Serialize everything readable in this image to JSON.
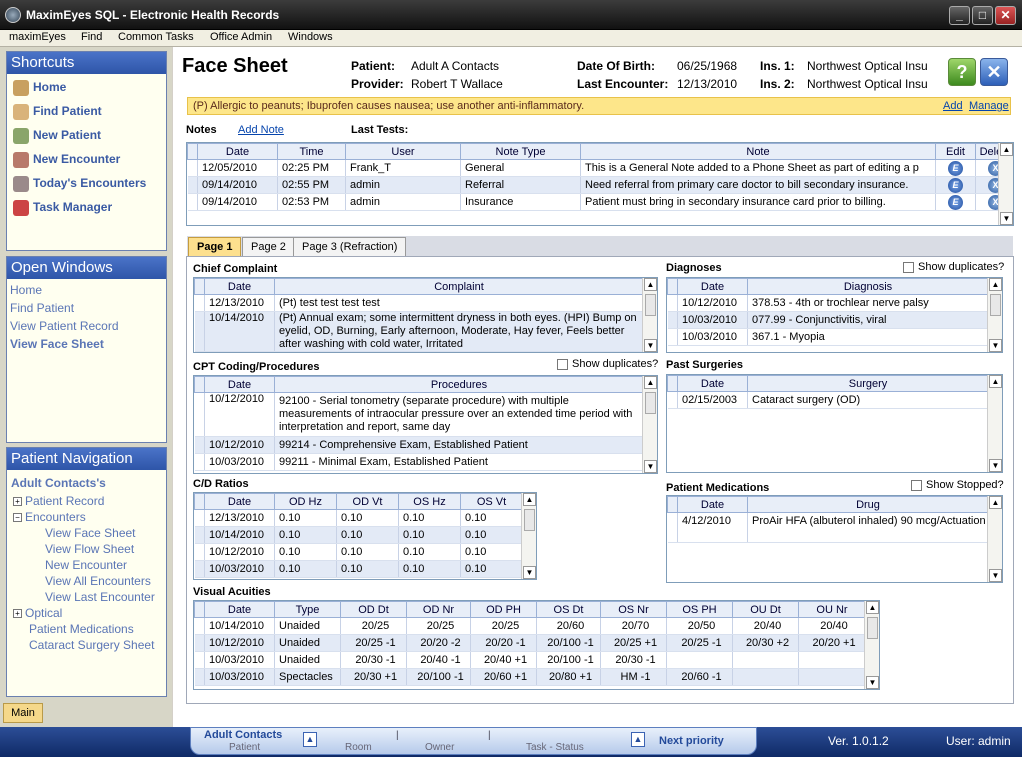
{
  "window": {
    "title": "MaximEyes SQL - Electronic Health Records"
  },
  "menu": [
    "maximEyes",
    "Find",
    "Common Tasks",
    "Office Admin",
    "Windows"
  ],
  "shortcuts": {
    "title": "Shortcuts",
    "items": [
      "Home",
      "Find Patient",
      "New Patient",
      "New Encounter",
      "Today's Encounters",
      "Task Manager"
    ]
  },
  "open_windows": {
    "title": "Open Windows",
    "items": [
      "Home",
      "Find Patient",
      "View Patient Record",
      "View Face Sheet"
    ]
  },
  "patient_nav": {
    "title": "Patient Navigation",
    "patient": "Adult Contacts's",
    "patient_record": "Patient Record",
    "encounters": "Encounters",
    "enc_items": [
      "View Face Sheet",
      "View Flow Sheet",
      "New Encounter",
      "View All Encounters",
      "View Last Encounter"
    ],
    "optical": "Optical",
    "medications": "Patient Medications",
    "cataract": "Cataract Surgery Sheet"
  },
  "main_tab": "Main",
  "header": {
    "title": "Face Sheet",
    "patient_label": "Patient:",
    "patient": "Adult A Contacts",
    "provider_label": "Provider:",
    "provider": "Robert T Wallace",
    "dob_label": "Date Of Birth:",
    "dob": "06/25/1968",
    "last_enc_label": "Last Encounter:",
    "last_enc": "12/13/2010",
    "ins1_label": "Ins. 1:",
    "ins1": "Northwest  Optical Insu",
    "ins2_label": "Ins. 2:",
    "ins2": "Northwest  Optical Insu"
  },
  "alert": {
    "text": "(P) Allergic to peanuts; Ibuprofen causes nausea; use another anti-inflammatory.",
    "add": "Add",
    "manage": "Manage"
  },
  "notes": {
    "label": "Notes",
    "add_note": "Add Note",
    "last_tests": "Last Tests:",
    "columns": [
      "Date",
      "Time",
      "User",
      "Note Type",
      "Note",
      "Edit",
      "Delete"
    ],
    "rows": [
      [
        "12/05/2010",
        "02:25 PM",
        "Frank_T",
        "General",
        "This is a General Note added to a Phone Sheet as part of editing a p"
      ],
      [
        "09/14/2010",
        "02:55 PM",
        "admin",
        "Referral",
        "Need referral from primary care doctor to bill secondary insurance."
      ],
      [
        "09/14/2010",
        "02:53 PM",
        "admin",
        "Insurance",
        "Patient must bring in secondary insurance card prior to billing."
      ]
    ]
  },
  "tabs": [
    "Page 1",
    "Page 2",
    "Page 3 (Refraction)"
  ],
  "chief": {
    "title": "Chief Complaint",
    "columns": [
      "Date",
      "Complaint"
    ],
    "rows": [
      [
        "12/13/2010",
        "(Pt) test test test test"
      ],
      [
        "10/14/2010",
        "(Pt) Annual exam; some intermittent dryness in both eyes. (HPI) Bump on eyelid, OD, Burning, Early afternoon, Moderate, Hay fever, Feels better after washing with cold water, Irritated"
      ]
    ]
  },
  "diagnoses": {
    "title": "Diagnoses",
    "show_dup": "Show duplicates?",
    "columns": [
      "Date",
      "Diagnosis"
    ],
    "rows": [
      [
        "10/12/2010",
        "378.53 - 4th or trochlear nerve palsy"
      ],
      [
        "10/03/2010",
        "077.99 - Conjunctivitis, viral"
      ],
      [
        "10/03/2010",
        "367.1 - Myopia"
      ]
    ]
  },
  "cpt": {
    "title": "CPT Coding/Procedures",
    "show_dup": "Show duplicates?",
    "columns": [
      "Date",
      "Procedures"
    ],
    "rows": [
      [
        "10/12/2010",
        "92100 - Serial tonometry (separate procedure) with multiple measurements of intraocular pressure over an extended time period with interpretation and report, same day"
      ],
      [
        "10/12/2010",
        "99214 - Comprehensive Exam, Established Patient"
      ],
      [
        "10/03/2010",
        "99211 - Minimal Exam, Established Patient"
      ]
    ]
  },
  "surgeries": {
    "title": "Past Surgeries",
    "columns": [
      "Date",
      "Surgery"
    ],
    "rows": [
      [
        "02/15/2003",
        "Cataract surgery (OD)"
      ]
    ]
  },
  "cd": {
    "title": "C/D Ratios",
    "columns": [
      "Date",
      "OD Hz",
      "OD Vt",
      "OS Hz",
      "OS Vt"
    ],
    "rows": [
      [
        "12/13/2010",
        "0.10",
        "0.10",
        "0.10",
        "0.10"
      ],
      [
        "10/14/2010",
        "0.10",
        "0.10",
        "0.10",
        "0.10"
      ],
      [
        "10/12/2010",
        "0.10",
        "0.10",
        "0.10",
        "0.10"
      ],
      [
        "10/03/2010",
        "0.10",
        "0.10",
        "0.10",
        "0.10"
      ]
    ]
  },
  "meds": {
    "title": "Patient Medications",
    "show_stopped": "Show Stopped?",
    "columns": [
      "Date",
      "Drug"
    ],
    "rows": [
      [
        "4/12/2010",
        "ProAir HFA (albuterol inhaled) 90 mcg/Actuation"
      ]
    ]
  },
  "va": {
    "title": "Visual Acuities",
    "columns": [
      "Date",
      "Type",
      "OD Dt",
      "OD Nr",
      "OD PH",
      "OS Dt",
      "OS Nr",
      "OS PH",
      "OU Dt",
      "OU Nr"
    ],
    "rows": [
      [
        "10/14/2010",
        "Unaided",
        "20/25",
        "20/25",
        "20/25",
        "20/60",
        "20/70",
        "20/50",
        "20/40",
        "20/40"
      ],
      [
        "10/12/2010",
        "Unaided",
        "20/25 -1",
        "20/20 -2",
        "20/20 -1",
        "20/100 -1",
        "20/25 +1",
        "20/25 -1",
        "20/30 +2",
        "20/20 +1"
      ],
      [
        "10/03/2010",
        "Unaided",
        "20/30 -1",
        "20/40 -1",
        "20/40 +1",
        "20/100 -1",
        "20/30 -1",
        "",
        "",
        ""
      ],
      [
        "10/03/2010",
        "Spectacles",
        "20/30 +1",
        "20/100 -1",
        "20/60 +1",
        "20/80 +1",
        "HM -1",
        "20/60 -1",
        "",
        ""
      ]
    ]
  },
  "status": {
    "patient": "Adult Contacts",
    "patient_lbl": "Patient",
    "room_lbl": "Room",
    "owner_lbl": "Owner",
    "task_lbl": "Task - Status",
    "next": "Next priority",
    "version": "Ver. 1.0.1.2",
    "user": "User: admin"
  }
}
